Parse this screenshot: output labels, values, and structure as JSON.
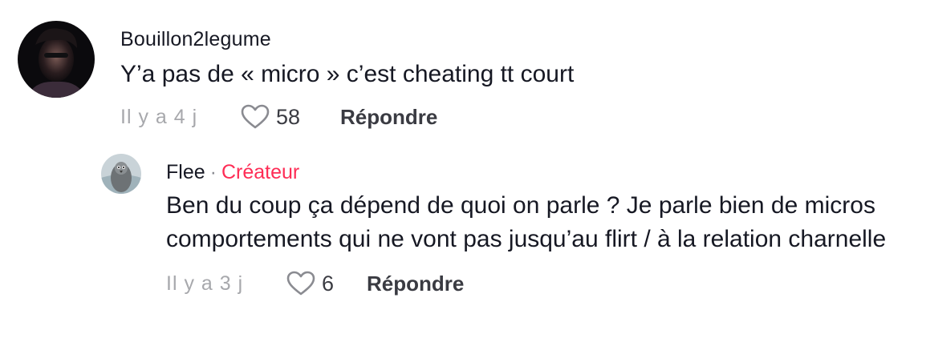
{
  "comments": [
    {
      "username": "Bouillon2legume",
      "text": "Y’a pas de « micro » c’est cheating tt court",
      "time": "Il y a 4 j",
      "likes": "58",
      "reply_label": "Répondre"
    }
  ],
  "reply": {
    "username": "Flee",
    "separator": "·",
    "badge": "Créateur",
    "text": "Ben du coup ça dépend de quoi on parle ? Je parle bien de micros comportements qui ne vont pas jusqu’au flirt / à la relation charnelle",
    "time": "Il y a 3 j",
    "likes": "6",
    "reply_label": "Répondre"
  },
  "colors": {
    "creator_badge": "#fe2c55",
    "muted": "#8a8b91"
  },
  "icons": {
    "like": "heart-outline-icon"
  }
}
